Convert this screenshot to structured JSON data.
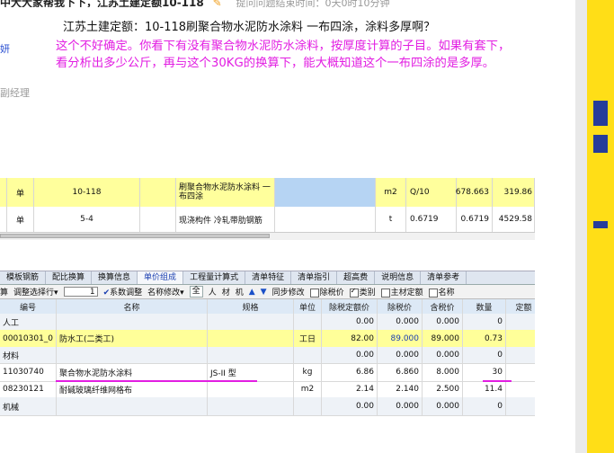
{
  "forum": {
    "question_title": "中大大家帮我下下，江苏土建定额10-118",
    "question_meta": "提问问题结束时间：0天0时10分钟",
    "question_text": "江苏土建定额：10-118刷聚合物水泥防水涂料 一布四涂，涂料多厚啊？",
    "answer_line1": "这个不好确定。你看下有没有聚合物水泥防水涂料，按厚度计算的子目。如果有套下，",
    "answer_line2": "看分析出多少公斤，再与这个30KG的换算下，能大概知道这个一布四涂的是多厚。",
    "side_user": "妍",
    "side_role": "副经理"
  },
  "upper_rows": [
    {
      "type": "单",
      "code": "10-118",
      "name": "刷聚合物水泥防水涂料 一布四涂",
      "unit": "m2",
      "qty": "Q/10",
      "v1": "678.663",
      "v2": "319.86"
    },
    {
      "type": "单",
      "code": "5-4",
      "name": "现浇构件 冷轧带肋钢筋",
      "unit": "t",
      "qty": "0.6719",
      "v1": "0.6719",
      "v2": "4529.58"
    }
  ],
  "tabs": [
    "模板钢筋",
    "配比换算",
    "换算信息",
    "单价组成",
    "工程量计算式",
    "清单特征",
    "清单指引",
    "超高费",
    "说明信息",
    "清单参考"
  ],
  "active_tab": 3,
  "toolbar": {
    "calc_label": "算",
    "adjust_label": "调整选择行",
    "spin_value": "1",
    "coeff_label": "系数调整",
    "name_fix_label": "名称修改",
    "seg_all": "全",
    "seg_labels": [
      "人",
      "材",
      "机"
    ],
    "sync_label": "同步修改",
    "tax_label": "除税价",
    "class_label": "类别",
    "main_label": "主材定额",
    "name_label": "名称"
  },
  "grid": {
    "headers": [
      "编号",
      "名称",
      "规格",
      "单位",
      "除税定额价",
      "除税价",
      "含税价",
      "数量",
      "定额"
    ],
    "rows": [
      {
        "kind": "section",
        "code": "人工",
        "name": "",
        "spec": "",
        "unit": "",
        "p1": "0.00",
        "p2": "0.000",
        "p3": "0.000",
        "qty": "0"
      },
      {
        "kind": "item-y",
        "code": "00010301_0",
        "name": "防水工(二类工)",
        "spec": "",
        "unit": "工日",
        "p1": "82.00",
        "p2": "89.000",
        "p3": "89.000",
        "qty": "0.73"
      },
      {
        "kind": "section",
        "code": "材料",
        "name": "",
        "spec": "",
        "unit": "",
        "p1": "0.00",
        "p2": "0.000",
        "p3": "0.000",
        "qty": "0"
      },
      {
        "kind": "item",
        "code": "11030740",
        "name": "聚合物水泥防水涂料",
        "spec": "JS-II 型",
        "unit": "kg",
        "p1": "6.86",
        "p2": "6.860",
        "p3": "8.000",
        "qty": "30"
      },
      {
        "kind": "item",
        "code": "08230121",
        "name": "耐碱玻璃纤维网格布",
        "spec": "",
        "unit": "m2",
        "p1": "2.14",
        "p2": "2.140",
        "p3": "2.500",
        "qty": "11.4"
      },
      {
        "kind": "section",
        "code": "机械",
        "name": "",
        "spec": "",
        "unit": "",
        "p1": "0.00",
        "p2": "0.000",
        "p3": "0.000",
        "qty": "0"
      }
    ]
  },
  "colors": {
    "answer": "#e21ee2",
    "strip": "#ffde17",
    "strip_mark": "#263c9a",
    "row_highlight": "#ffff99"
  }
}
